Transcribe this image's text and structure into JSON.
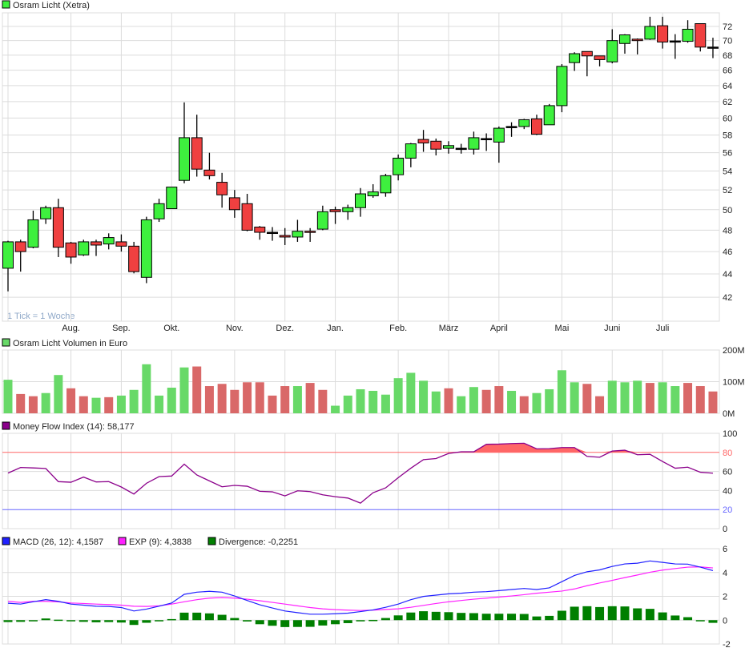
{
  "colors": {
    "up": "#3ef03e",
    "down": "#f04040",
    "vol_up": "#68d968",
    "vol_down": "#d96868",
    "mfi": "#8b008b",
    "mfi_fill": "#ff6666",
    "upper": "#ff6666",
    "lower": "#6666ff",
    "macd": "#2020ff",
    "exp": "#ff20ff",
    "div": "#007f00",
    "grid": "#dcdcdc"
  },
  "chart_data": [
    {
      "type": "candlestick",
      "title": "Osram Licht (Xetra)",
      "note": "1 Tick = 1 Woche",
      "scale": "log",
      "ylim": [
        40.2,
        73.8
      ],
      "yticks": [
        42,
        44,
        46,
        48,
        50,
        52,
        54,
        56,
        58,
        60,
        62,
        64,
        66,
        68,
        70,
        72
      ],
      "months": [
        {
          "label": "Aug.",
          "week": 5
        },
        {
          "label": "Sep.",
          "week": 9
        },
        {
          "label": "Okt.",
          "week": 13
        },
        {
          "label": "Nov.",
          "week": 18
        },
        {
          "label": "Dez.",
          "week": 22
        },
        {
          "label": "Jan.",
          "week": 26
        },
        {
          "label": "Feb.",
          "week": 31
        },
        {
          "label": "März",
          "week": 35
        },
        {
          "label": "April",
          "week": 39
        },
        {
          "label": "Mai",
          "week": 44
        },
        {
          "label": "Juni",
          "week": 48
        },
        {
          "label": "Juli",
          "week": 52
        }
      ],
      "ohlc": [
        [
          44.5,
          47.0,
          42.5,
          46.9
        ],
        [
          46.9,
          47.1,
          44.2,
          46.0
        ],
        [
          46.4,
          49.9,
          46.3,
          49.0
        ],
        [
          49.1,
          50.4,
          48.6,
          50.2
        ],
        [
          50.2,
          51.1,
          45.5,
          46.4
        ],
        [
          46.8,
          46.9,
          44.9,
          45.5
        ],
        [
          45.7,
          47.1,
          45.6,
          46.9
        ],
        [
          46.9,
          47.1,
          45.6,
          46.6
        ],
        [
          46.7,
          47.7,
          46.2,
          47.3
        ],
        [
          46.9,
          47.6,
          46.0,
          46.5
        ],
        [
          46.5,
          46.9,
          44.05,
          44.2
        ],
        [
          43.7,
          49.3,
          43.2,
          49.0
        ],
        [
          49.1,
          51.1,
          48.8,
          50.6
        ],
        [
          50.1,
          52.3,
          50.1,
          52.3
        ],
        [
          53.0,
          61.9,
          52.7,
          57.7
        ],
        [
          57.7,
          60.4,
          53.4,
          54.2
        ],
        [
          54.1,
          56.0,
          53.1,
          53.5
        ],
        [
          52.8,
          53.8,
          50.2,
          51.5
        ],
        [
          51.2,
          52.0,
          49.2,
          50.0
        ],
        [
          50.6,
          51.6,
          47.9,
          48.0
        ],
        [
          48.3,
          48.4,
          47.1,
          47.8
        ],
        [
          47.8,
          48.3,
          47.0,
          47.8
        ],
        [
          47.5,
          48.2,
          46.6,
          47.35
        ],
        [
          47.35,
          49.0,
          46.9,
          47.9
        ],
        [
          47.9,
          48.2,
          46.9,
          47.8
        ],
        [
          48.1,
          50.4,
          48.0,
          49.8
        ],
        [
          50.0,
          50.3,
          48.6,
          49.8
        ],
        [
          49.8,
          50.5,
          49.0,
          50.2
        ],
        [
          50.2,
          52.2,
          49.3,
          51.6
        ],
        [
          51.4,
          52.6,
          51.2,
          51.8
        ],
        [
          51.7,
          53.7,
          51.3,
          53.5
        ],
        [
          53.6,
          55.8,
          53.0,
          55.4
        ],
        [
          55.4,
          57.1,
          54.4,
          57.0
        ],
        [
          57.5,
          58.6,
          56.1,
          57.1
        ],
        [
          57.3,
          57.6,
          55.7,
          56.4
        ],
        [
          56.5,
          57.3,
          55.9,
          56.8
        ],
        [
          56.5,
          57.0,
          55.9,
          56.5
        ],
        [
          56.4,
          58.4,
          55.8,
          57.7
        ],
        [
          57.6,
          58.2,
          56.2,
          57.6
        ],
        [
          57.2,
          59.0,
          54.9,
          58.8
        ],
        [
          59.0,
          59.5,
          57.8,
          59.0
        ],
        [
          59.0,
          59.9,
          58.7,
          59.8
        ],
        [
          59.9,
          60.4,
          58.0,
          58.1
        ],
        [
          59.2,
          61.7,
          59.2,
          61.5
        ],
        [
          61.5,
          66.8,
          60.7,
          66.5
        ],
        [
          67.0,
          68.4,
          65.9,
          68.2
        ],
        [
          68.5,
          68.5,
          65.2,
          67.9
        ],
        [
          67.9,
          67.9,
          66.5,
          67.4
        ],
        [
          67.1,
          71.6,
          66.9,
          70.0
        ],
        [
          69.6,
          70.9,
          68.2,
          70.8
        ],
        [
          70.2,
          70.3,
          68.1,
          70.0
        ],
        [
          70.2,
          73.4,
          70.1,
          72.0
        ],
        [
          72.1,
          73.4,
          68.9,
          69.8
        ],
        [
          69.95,
          70.9,
          67.5,
          69.95
        ],
        [
          69.9,
          72.9,
          69.7,
          71.6
        ],
        [
          72.4,
          72.4,
          68.5,
          69.1
        ],
        [
          69.1,
          70.4,
          67.6,
          69.1
        ]
      ]
    },
    {
      "type": "bar",
      "title": "Osram Licht Volumen in Euro",
      "ylim": [
        0,
        200
      ],
      "yticks": [
        {
          "v": 0,
          "label": "0M"
        },
        {
          "v": 100,
          "label": "100M"
        },
        {
          "v": 200,
          "label": "200M"
        }
      ],
      "values": [
        106,
        61,
        54,
        64,
        121,
        79,
        54,
        49,
        51,
        56,
        74,
        155,
        56,
        81,
        145,
        148,
        86,
        93,
        74,
        98,
        98,
        56,
        86,
        86,
        96,
        74,
        24,
        56,
        76,
        71,
        59,
        111,
        128,
        103,
        69,
        79,
        54,
        83,
        74,
        86,
        71,
        54,
        64,
        76,
        136,
        98,
        93,
        54,
        103,
        98,
        103,
        96,
        98,
        86,
        96,
        86,
        69
      ],
      "direction": "udduudduduuuuuuddddddddudduuuuuuuuuduuddudauuudduuuduuddd"
    },
    {
      "type": "line",
      "title": "Money Flow Index (14): 58,177",
      "ylim": [
        0,
        100
      ],
      "yticks": [
        0,
        20,
        40,
        60,
        80,
        100
      ],
      "upper": 80,
      "lower": 20,
      "values": [
        58.3,
        64.2,
        63.7,
        63.1,
        49.3,
        48.7,
        54.1,
        49.0,
        49.3,
        43.7,
        36.3,
        47.6,
        54.6,
        55.2,
        67.6,
        56.3,
        50.1,
        43.9,
        45.4,
        44.5,
        39.2,
        38.6,
        34.4,
        39.7,
        38.9,
        35.5,
        33.5,
        32.1,
        26.8,
        37.7,
        42.8,
        53.5,
        63.4,
        72.4,
        73.5,
        78.9,
        80.6,
        80.6,
        88.5,
        88.7,
        89.3,
        89.6,
        83.7,
        83.9,
        85.1,
        85.1,
        75.8,
        74.9,
        81.4,
        82.3,
        77.5,
        78.0,
        70.4,
        63.4,
        64.5,
        59.2,
        58.2
      ]
    },
    {
      "type": "line",
      "legend": [
        "MACD (26, 12): 4,1587",
        "EXP (9): 4,3838",
        "Divergence: -0,2251"
      ],
      "ylim": [
        -2,
        6
      ],
      "yticks": [
        -2,
        0,
        2,
        4,
        6
      ],
      "series": [
        {
          "name": "MACD",
          "values": [
            1.42,
            1.35,
            1.54,
            1.72,
            1.58,
            1.35,
            1.26,
            1.17,
            1.15,
            1.06,
            0.77,
            0.93,
            1.17,
            1.44,
            2.17,
            2.35,
            2.42,
            2.35,
            2.03,
            1.65,
            1.29,
            1.02,
            0.77,
            0.63,
            0.5,
            0.5,
            0.54,
            0.59,
            0.72,
            0.86,
            1.08,
            1.35,
            1.72,
            1.99,
            2.1,
            2.21,
            2.26,
            2.35,
            2.39,
            2.48,
            2.57,
            2.66,
            2.57,
            2.71,
            3.23,
            3.75,
            4.06,
            4.22,
            4.51,
            4.72,
            4.78,
            4.97,
            4.85,
            4.72,
            4.7,
            4.45,
            4.1587
          ]
        },
        {
          "name": "EXP",
          "values": [
            1.58,
            1.49,
            1.58,
            1.58,
            1.54,
            1.44,
            1.4,
            1.35,
            1.31,
            1.26,
            1.17,
            1.15,
            1.2,
            1.35,
            1.54,
            1.72,
            1.85,
            1.9,
            1.85,
            1.76,
            1.63,
            1.49,
            1.35,
            1.2,
            1.06,
            0.95,
            0.88,
            0.84,
            0.81,
            0.84,
            0.9,
            0.95,
            1.08,
            1.24,
            1.4,
            1.54,
            1.65,
            1.76,
            1.85,
            1.94,
            2.03,
            2.14,
            2.26,
            2.35,
            2.44,
            2.62,
            2.89,
            3.12,
            3.34,
            3.57,
            3.79,
            4.02,
            4.2,
            4.33,
            4.45,
            4.47,
            4.3838
          ]
        }
      ]
    }
  ]
}
